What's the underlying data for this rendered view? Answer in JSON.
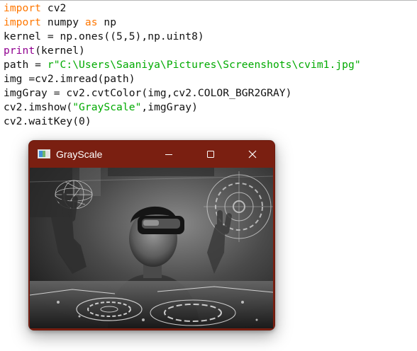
{
  "code_lines": [
    {
      "segments": [
        {
          "t": "import",
          "c": "kw"
        },
        {
          "t": " cv2",
          "c": ""
        }
      ]
    },
    {
      "segments": [
        {
          "t": "import",
          "c": "kw"
        },
        {
          "t": " numpy ",
          "c": ""
        },
        {
          "t": "as",
          "c": "kw"
        },
        {
          "t": " np",
          "c": ""
        }
      ]
    },
    {
      "segments": [
        {
          "t": "kernel = np.ones((5,5),np.uint8)",
          "c": ""
        }
      ]
    },
    {
      "segments": [
        {
          "t": "print",
          "c": "bi"
        },
        {
          "t": "(kernel)",
          "c": ""
        }
      ]
    },
    {
      "segments": [
        {
          "t": "path = ",
          "c": ""
        },
        {
          "t": "r\"C:\\Users\\Saaniya\\Pictures\\Screenshots\\cvim1.jpg\"",
          "c": "str"
        }
      ]
    },
    {
      "segments": [
        {
          "t": "img =cv2.imread(path)",
          "c": ""
        }
      ]
    },
    {
      "segments": [
        {
          "t": "imgGray = cv2.cvtColor(img,cv2.COLOR_BGR2GRAY)",
          "c": ""
        }
      ]
    },
    {
      "segments": [
        {
          "t": "cv2.imshow(",
          "c": ""
        },
        {
          "t": "\"GrayScale\"",
          "c": "str"
        },
        {
          "t": ",imgGray)",
          "c": ""
        }
      ]
    },
    {
      "segments": [
        {
          "t": "cv2.waitKey(0)",
          "c": ""
        }
      ]
    }
  ],
  "window": {
    "title": "GrayScale",
    "controls": {
      "minimize": "minimize-icon",
      "maximize": "maximize-icon",
      "close": "close-icon"
    },
    "titlebar_color": "#7a1f11"
  },
  "colors": {
    "keyword": "#ff7700",
    "builtin": "#900090",
    "string": "#00aa00",
    "text": "#111111"
  }
}
